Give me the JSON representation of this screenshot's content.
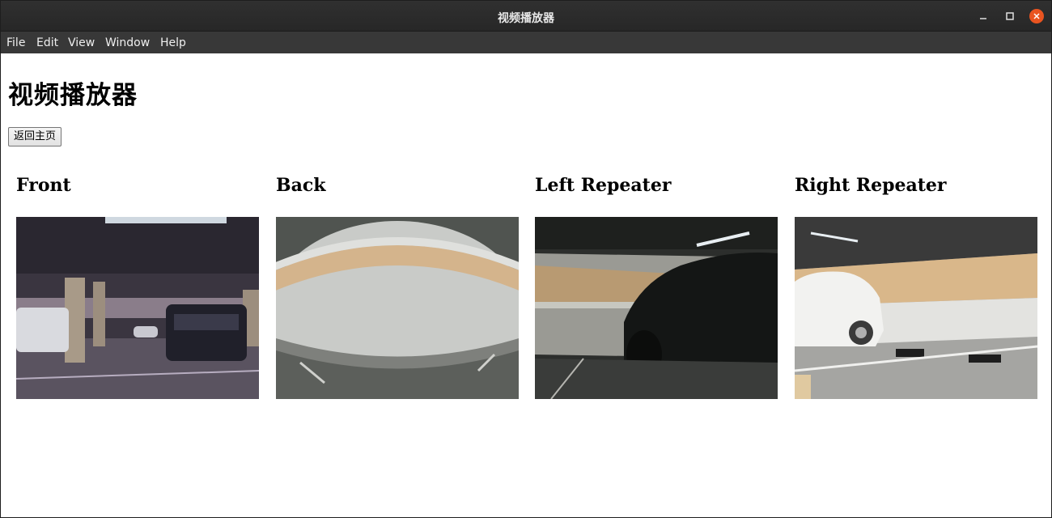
{
  "window": {
    "title": "视频播放器"
  },
  "menubar": {
    "items": [
      "File",
      "Edit",
      "View",
      "Window",
      "Help"
    ]
  },
  "page": {
    "title": "视频播放器",
    "back_button_label": "返回主页"
  },
  "cameras": [
    {
      "label": "Front"
    },
    {
      "label": "Back"
    },
    {
      "label": "Left Repeater"
    },
    {
      "label": "Right Repeater"
    }
  ],
  "colors": {
    "close_button": "#e95420",
    "titlebar": "#2c2c2c",
    "menubar": "#383838"
  }
}
